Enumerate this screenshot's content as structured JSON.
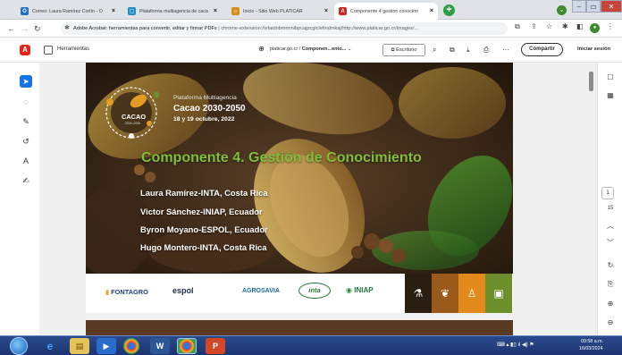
{
  "browser": {
    "tabs": [
      {
        "title": "Correo: Laura Ramírez Cortín - O",
        "favicon_color": "#1f6fc4",
        "favicon": "O",
        "active": false
      },
      {
        "title": "Plataforma multiagencia de caca",
        "favicon_color": "#1f8ec4",
        "favicon": "▢",
        "active": false
      },
      {
        "title": "Inicio - Sitio Web PLATICAR",
        "favicon_color": "#d98c1a",
        "favicon": "☼",
        "active": false
      },
      {
        "title": "Componente 4 gestion conocimi",
        "favicon_color": "#d3261b",
        "favicon": "A",
        "active": true
      }
    ],
    "new_tab": "+",
    "url_prefix": "Adobe Acrobat: herramientas para convertir, editar y firmar PDFs",
    "url_rest": "chrome-extension://efaidnbmnnnibpcajpcglclefindmkaj/http://www.platicar.go.cr/images/...",
    "profile_initial": "●"
  },
  "acrobat": {
    "tools_label": "Herramientas",
    "domain": "platicar.go.cr",
    "separator": "/",
    "file_name": "Componen...ento...",
    "edit_label": "Escritorio",
    "share_label": "Compartir",
    "signin_label": "Iniciar sesión",
    "page_number": "1",
    "page_count": "15"
  },
  "slide": {
    "platform_title": "Plataforma Multiagencia",
    "cacao_title": "Cacao 2030-2050",
    "dates": "18 y 19 octubre, 2022",
    "badge_text": "CACAO",
    "badge_sub": "2030-2050",
    "component_title": "Componente 4. Gestión de Conocimiento",
    "authors": [
      "Laura Ramírez-INTA, Costa Rica",
      "Victor Sánchez-INIAP, Ecuador",
      "Byron Moyano-ESPOL, Ecuador",
      "Hugo Montero-INTA, Costa Rica"
    ],
    "sponsors": [
      "FONTAGRO",
      "espol",
      "AGROSAVIA",
      "inta",
      "INIAP"
    ],
    "square_colors": [
      "#2a1d12",
      "#9c5a1a",
      "#e38a1c",
      "#6c8e2b"
    ]
  },
  "taskbar": {
    "time": "09:58 a.m.",
    "date": "16/03/2024"
  }
}
